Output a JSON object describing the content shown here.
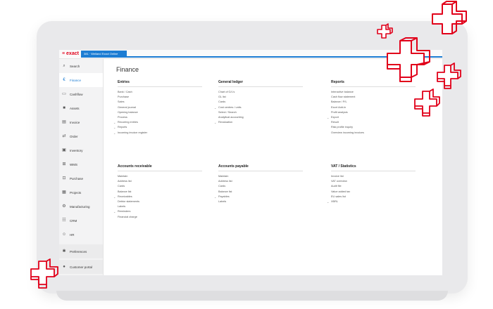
{
  "app": {
    "logo": "≡ exact",
    "tab": "381 · Weiland Exact Online"
  },
  "sidebar": {
    "items": [
      {
        "label": "Search",
        "icon": "search-icon"
      },
      {
        "label": "Finance",
        "icon": "euro-icon"
      },
      {
        "label": "Cashflow",
        "icon": "cashflow-icon"
      },
      {
        "label": "Assets",
        "icon": "assets-icon"
      },
      {
        "label": "Invoice",
        "icon": "invoice-icon"
      },
      {
        "label": "Order",
        "icon": "order-icon"
      },
      {
        "label": "Inventory",
        "icon": "inventory-icon"
      },
      {
        "label": "WMS",
        "icon": "wms-icon"
      },
      {
        "label": "Purchase",
        "icon": "purchase-icon"
      },
      {
        "label": "Projects",
        "icon": "projects-icon"
      },
      {
        "label": "Manufacturing",
        "icon": "manufacturing-icon"
      },
      {
        "label": "CRM",
        "icon": "crm-icon"
      },
      {
        "label": "HR",
        "icon": "hr-icon"
      },
      {
        "label": "Preferences",
        "icon": "gear-icon"
      },
      {
        "label": "Customer portal",
        "icon": "portal-icon"
      }
    ],
    "active": "Finance"
  },
  "main": {
    "title": "Finance",
    "sections": [
      {
        "title": "Entries",
        "items": [
          {
            "label": "Bank / Cash",
            "chev": false
          },
          {
            "label": "Purchase",
            "chev": false
          },
          {
            "label": "Sales",
            "chev": false
          },
          {
            "label": "General journal",
            "chev": false
          },
          {
            "label": "Opening balance",
            "chev": false
          },
          {
            "label": "Process",
            "chev": false
          },
          {
            "label": "Recurring entries",
            "chev": true
          },
          {
            "label": "Reports",
            "chev": true
          },
          {
            "label": "Incoming invoice register",
            "chev": true
          }
        ]
      },
      {
        "title": "General ledger",
        "items": [
          {
            "label": "Chart of G/L's",
            "chev": false
          },
          {
            "label": "GL list",
            "chev": false
          },
          {
            "label": "Cards",
            "chev": false
          },
          {
            "label": "Cost centres / units",
            "chev": true
          },
          {
            "label": "Select / Search",
            "chev": false
          },
          {
            "label": "Analytical accounting",
            "chev": false
          },
          {
            "label": "Revaluation",
            "chev": true
          }
        ]
      },
      {
        "title": "Reports",
        "items": [
          {
            "label": "Interactive balance",
            "chev": false
          },
          {
            "label": "Cash flow statement",
            "chev": false
          },
          {
            "label": "Balance / P/L",
            "chev": false
          },
          {
            "label": "Excel Add-in",
            "chev": false
          },
          {
            "label": "Profit analysis",
            "chev": false
          },
          {
            "label": "Export",
            "chev": true
          },
          {
            "label": "Result",
            "chev": false
          },
          {
            "label": "Risk profile inquiry",
            "chev": false
          },
          {
            "label": "Overview incoming invoices",
            "chev": false
          }
        ]
      },
      {
        "title": "Accounts receivable",
        "items": [
          {
            "label": "Maintain",
            "chev": false
          },
          {
            "label": "Address list",
            "chev": false
          },
          {
            "label": "Cards",
            "chev": false
          },
          {
            "label": "Balance list",
            "chev": false
          },
          {
            "label": "Receivables",
            "chev": true
          },
          {
            "label": "Debtor statements",
            "chev": false
          },
          {
            "label": "Labels",
            "chev": false
          },
          {
            "label": "Reminders",
            "chev": true
          },
          {
            "label": "Financial charge",
            "chev": false
          }
        ]
      },
      {
        "title": "Accounts payable",
        "items": [
          {
            "label": "Maintain",
            "chev": false
          },
          {
            "label": "Address list",
            "chev": false
          },
          {
            "label": "Cards",
            "chev": false
          },
          {
            "label": "Balance list",
            "chev": false
          },
          {
            "label": "Payables",
            "chev": true
          },
          {
            "label": "Labels",
            "chev": false
          }
        ]
      },
      {
        "title": "VAT / Statistics",
        "items": [
          {
            "label": "Invoice list",
            "chev": false
          },
          {
            "label": "VAT overview",
            "chev": false
          },
          {
            "label": "Audit file",
            "chev": false
          },
          {
            "label": "Value added tax",
            "chev": false
          },
          {
            "label": "EU sales list",
            "chev": false
          },
          {
            "label": "XBRL",
            "chev": true
          }
        ]
      }
    ]
  },
  "colors": {
    "accent": "#1d7dd3",
    "brand": "#e1001a"
  }
}
